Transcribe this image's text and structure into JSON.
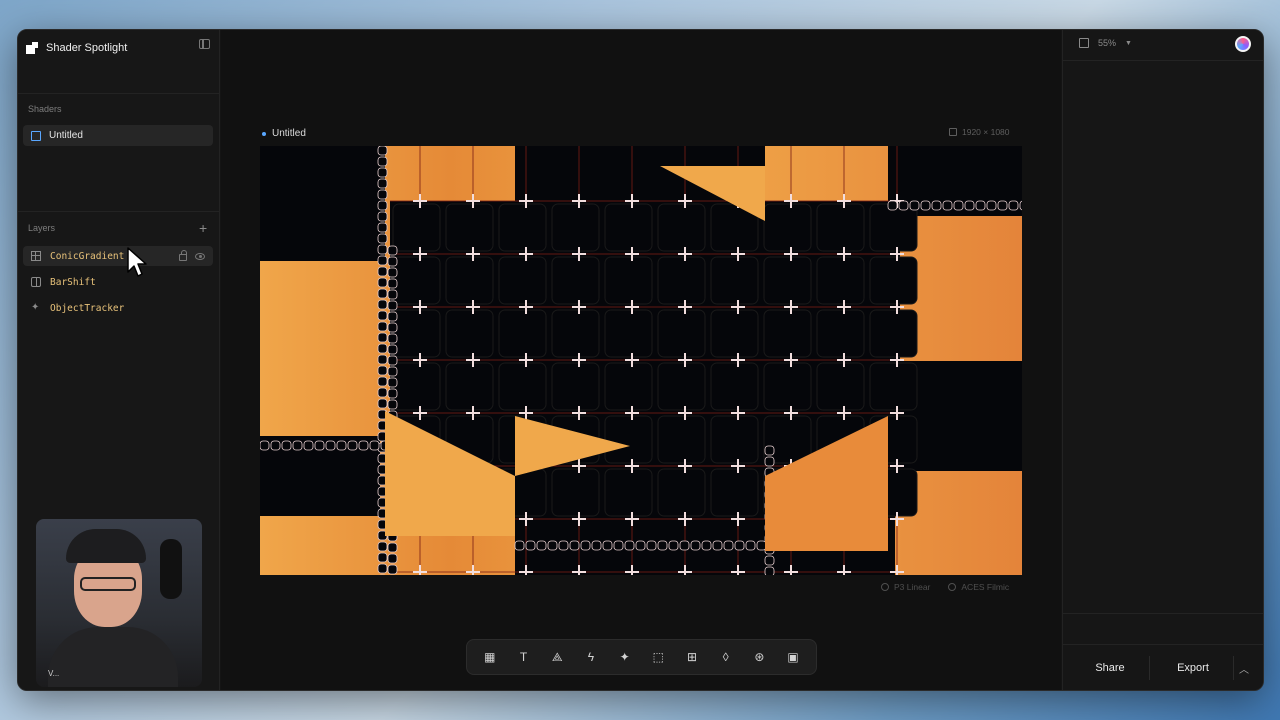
{
  "app": {
    "title": "Shader Spotlight"
  },
  "sidebar": {
    "shaders_label": "Shaders",
    "shaders": [
      {
        "name": "Untitled"
      }
    ],
    "layers_label": "Layers",
    "layers": [
      {
        "name": "ConicGradient",
        "icon": "grid-icon",
        "selected": true
      },
      {
        "name": "BarShift",
        "icon": "bars-icon",
        "selected": false
      },
      {
        "name": "ObjectTracker",
        "icon": "sparkle-icon",
        "selected": false
      }
    ]
  },
  "webcam": {
    "label": "V..."
  },
  "canvas": {
    "title": "Untitled",
    "size": "1920 × 1080",
    "color_space": "P3 Linear",
    "tonemap": "ACES Filmic"
  },
  "toolbar": {
    "tools": [
      {
        "name": "checker-tool",
        "glyph": "▦"
      },
      {
        "name": "text-tool",
        "glyph": "T"
      },
      {
        "name": "shapes-tool",
        "glyph": "⟁"
      },
      {
        "name": "lightning-tool",
        "glyph": "ϟ"
      },
      {
        "name": "sparkle-tool",
        "glyph": "✦"
      },
      {
        "name": "select-tool",
        "glyph": "⬚"
      },
      {
        "name": "grid-tool",
        "glyph": "⊞"
      },
      {
        "name": "drop-tool",
        "glyph": "◊"
      },
      {
        "name": "blend-tool",
        "glyph": "⊛"
      },
      {
        "name": "image-tool",
        "glyph": "▣"
      }
    ]
  },
  "right_panel": {
    "zoom": "55%",
    "share_label": "Share",
    "export_label": "Export"
  },
  "colors": {
    "accent": "#5aa7ff",
    "layer_text": "#e8c27a",
    "canvas_orange": "#f0a64a",
    "canvas_dark": "#05060a"
  }
}
